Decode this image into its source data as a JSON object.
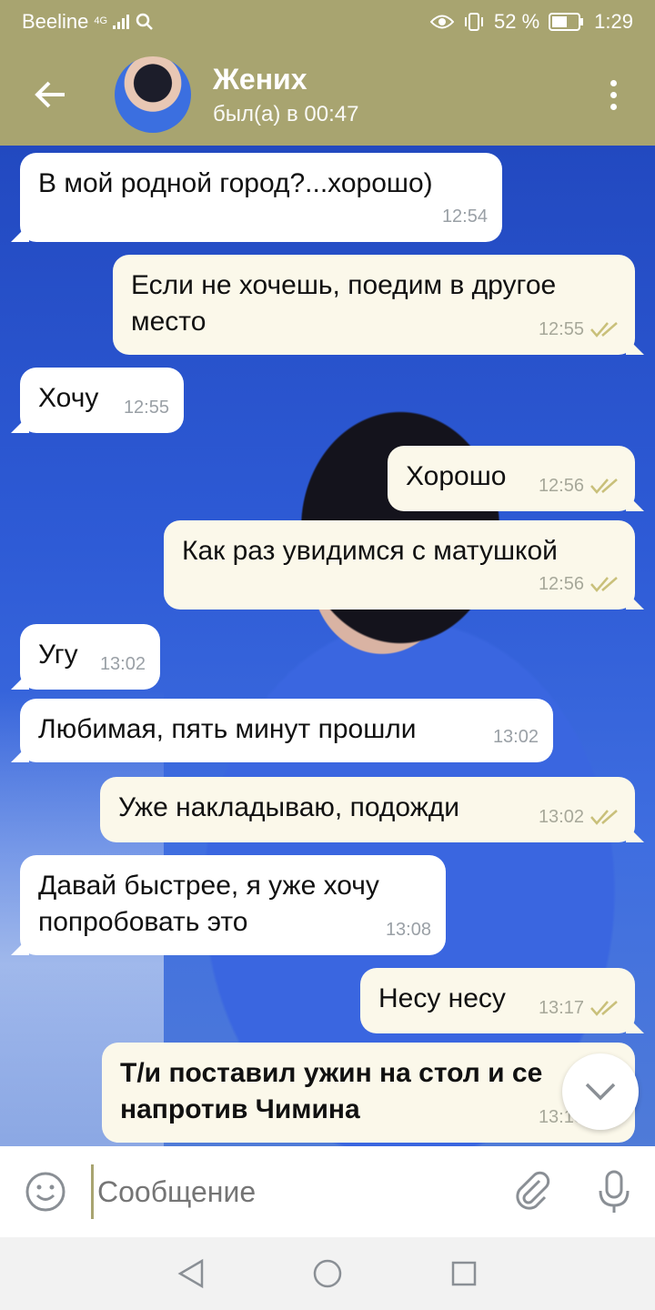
{
  "status_bar": {
    "carrier": "Beeline",
    "network": "4G",
    "battery": "52 %",
    "time": "1:29"
  },
  "header": {
    "contact_name": "Жених",
    "contact_status": "был(а) в 00:47"
  },
  "messages": [
    {
      "direction": "in",
      "text": "В мой родной город?...хорошо)",
      "time": "12:54"
    },
    {
      "direction": "out",
      "text": "Если не хочешь, поедим в другое\nместо",
      "time": "12:55",
      "read": true
    },
    {
      "direction": "in",
      "text": "Хочу",
      "time": "12:55"
    },
    {
      "direction": "out",
      "text": "Хорошо",
      "time": "12:56",
      "read": true
    },
    {
      "direction": "out",
      "text": "Как раз увидимся с матушкой",
      "time": "12:56",
      "read": true
    },
    {
      "direction": "in",
      "text": "Угу",
      "time": "13:02"
    },
    {
      "direction": "in",
      "text": "Любимая, пять минут прошли",
      "time": "13:02"
    },
    {
      "direction": "out",
      "text": "Уже накладываю, подожди",
      "time": "13:02",
      "read": true
    },
    {
      "direction": "in",
      "text": "Давай быстрее, я уже хочу\nпопробовать это",
      "time": "13:08"
    },
    {
      "direction": "out",
      "text": "Несу несу",
      "time": "13:17",
      "read": true
    },
    {
      "direction": "out",
      "text": "Т/и поставил ужин на стол и се\nнапротив Чимина",
      "time": "13:18",
      "read": true
    }
  ],
  "input": {
    "placeholder": "Сообщение"
  },
  "colors": {
    "accent": "#a8a470",
    "incoming_bubble": "#ffffff",
    "outgoing_bubble": "#fbf8ea",
    "read_check": "#c9c07a"
  }
}
